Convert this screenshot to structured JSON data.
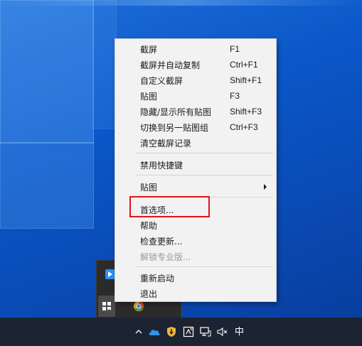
{
  "menu": {
    "groups": [
      [
        {
          "label": "截屏",
          "shortcut": "F1"
        },
        {
          "label": "截屏并自动复制",
          "shortcut": "Ctrl+F1"
        },
        {
          "label": "自定义截屏",
          "shortcut": "Shift+F1"
        },
        {
          "label": "贴图",
          "shortcut": "F3"
        },
        {
          "label": "隐藏/显示所有贴图",
          "shortcut": "Shift+F3"
        },
        {
          "label": "切换到另一贴图组",
          "shortcut": "Ctrl+F3"
        },
        {
          "label": "清空截屏记录",
          "shortcut": ""
        }
      ],
      [
        {
          "label": "禁用快捷键"
        }
      ],
      [
        {
          "label": "贴图",
          "submenu": true
        }
      ],
      [
        {
          "label": "首选项...",
          "highlighted": true
        },
        {
          "label": "帮助"
        },
        {
          "label": "检查更新..."
        },
        {
          "label": "解锁专业版...",
          "disabled": true
        }
      ],
      [
        {
          "label": "重新启动"
        },
        {
          "label": "退出"
        }
      ]
    ]
  },
  "taskbar": {
    "ime_label": "中",
    "tray_icons": [
      "chevron-up-icon",
      "onedrive-cloud-icon",
      "security-shield-icon",
      "snipaste-tray-icon",
      "network-icon",
      "volume-muted-icon"
    ]
  },
  "colors": {
    "highlight_border": "#e0141b",
    "menu_background": "#f2f2f2",
    "desktop_blue": "#0a4bb5",
    "taskbar": "#1c2433"
  }
}
